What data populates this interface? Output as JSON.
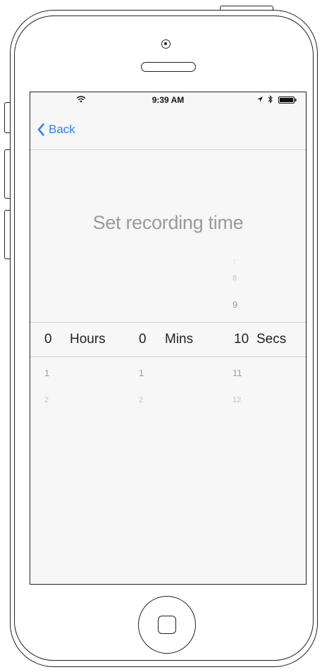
{
  "status_bar": {
    "time": "9:39 AM"
  },
  "nav": {
    "back_label": "Back",
    "back_icon": "chevron-left-icon",
    "accent_color": "#2a86f0"
  },
  "title": "Set recording time",
  "picker": {
    "hours": {
      "selected": "0",
      "unit": "Hours",
      "below": [
        "1",
        "2"
      ]
    },
    "mins": {
      "selected": "0",
      "unit": "Mins",
      "below": [
        "1",
        "2"
      ]
    },
    "secs": {
      "selected": "10",
      "unit": "Secs",
      "above": [
        "7",
        "8",
        "9"
      ],
      "below": [
        "11",
        "12"
      ]
    }
  }
}
